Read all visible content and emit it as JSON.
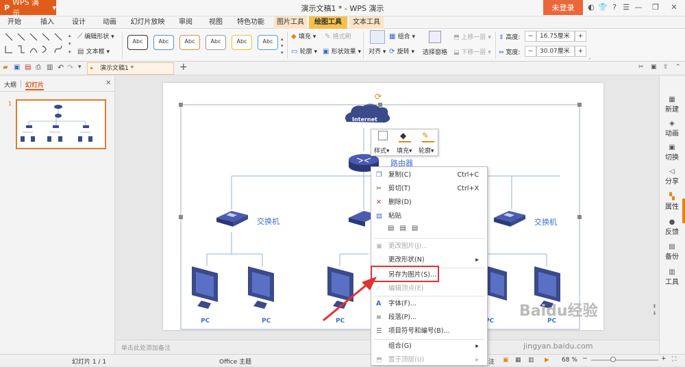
{
  "app": {
    "brand": "WPS 演示",
    "title": "演示文稿1 * - WPS 演示",
    "login": "未登录"
  },
  "menu": {
    "items": [
      "开始",
      "插入",
      "设计",
      "动画",
      "幻灯片放映",
      "审阅",
      "视图",
      "特色功能",
      "图片工具",
      "绘图工具",
      "文本工具"
    ],
    "active": "绘图工具"
  },
  "ribbon": {
    "edit_shape": "编辑形状",
    "text_box": "文本框",
    "style_label": "Abc",
    "fill": "填充",
    "format_painter": "格式刷",
    "outline": "轮廓",
    "shape_effects": "形状效果",
    "group": "组合",
    "align": "对齐",
    "rotate": "旋转",
    "selection_pane": "选择窗格",
    "bring_forward": "上移一层",
    "send_backward": "下移一层",
    "height_label": "高度:",
    "height_value": "16.75厘米",
    "width_label": "宽度:",
    "width_value": "30.07厘米",
    "minus": "−",
    "plus": "+"
  },
  "tabs": {
    "document": "演示文稿1 *"
  },
  "left_panel": {
    "outline_tab": "大纲",
    "slides_tab": "幻灯片",
    "slide_number": "1"
  },
  "slide": {
    "cloud_label": "Internet",
    "router_label": "路由器",
    "switch_label": "交换机",
    "pc_label": "PC"
  },
  "mini_toolbar": {
    "style": "样式",
    "fill": "填充",
    "outline": "轮廓"
  },
  "context_menu": {
    "items": [
      {
        "label": "复制(C)",
        "shortcut": "Ctrl+C",
        "disabled": false
      },
      {
        "label": "剪切(T)",
        "shortcut": "Ctrl+X",
        "disabled": false
      },
      {
        "label": "删除(D)",
        "shortcut": "",
        "disabled": false
      },
      {
        "label": "粘贴",
        "shortcut": "",
        "disabled": false
      },
      {
        "label": "更改图片(J)...",
        "shortcut": "",
        "disabled": true
      },
      {
        "label": "更改形状(N)",
        "shortcut": "",
        "disabled": false
      },
      {
        "label": "另存为图片(S)...",
        "shortcut": "",
        "disabled": false
      },
      {
        "label": "编辑顶点(E)",
        "shortcut": "",
        "disabled": true
      },
      {
        "label": "字体(F)...",
        "shortcut": "",
        "disabled": false
      },
      {
        "label": "段落(P)...",
        "shortcut": "",
        "disabled": false
      },
      {
        "label": "项目符号和编号(B)...",
        "shortcut": "",
        "disabled": false
      },
      {
        "label": "组合(G)",
        "shortcut": "",
        "disabled": false
      },
      {
        "label": "置于顶层(U)",
        "shortcut": "",
        "disabled": true
      }
    ]
  },
  "right_sidebar": [
    "新建",
    "动画",
    "切换",
    "分享",
    "属性",
    "反馈",
    "备份",
    "工具"
  ],
  "notes_placeholder": "单击此处添加备注",
  "status": {
    "slide": "幻灯片 1 / 1",
    "theme": "Office 主题",
    "notes": "注",
    "zoom": "68 %"
  },
  "watermark": {
    "brand": "Baidu经验",
    "url": "jingyan.baidu.com"
  },
  "colors": {
    "brand_orange": "#e05c1b",
    "active_tab": "#f6c04d",
    "highlight_red": "#e53030",
    "network_blue": "#3a4a8a"
  }
}
